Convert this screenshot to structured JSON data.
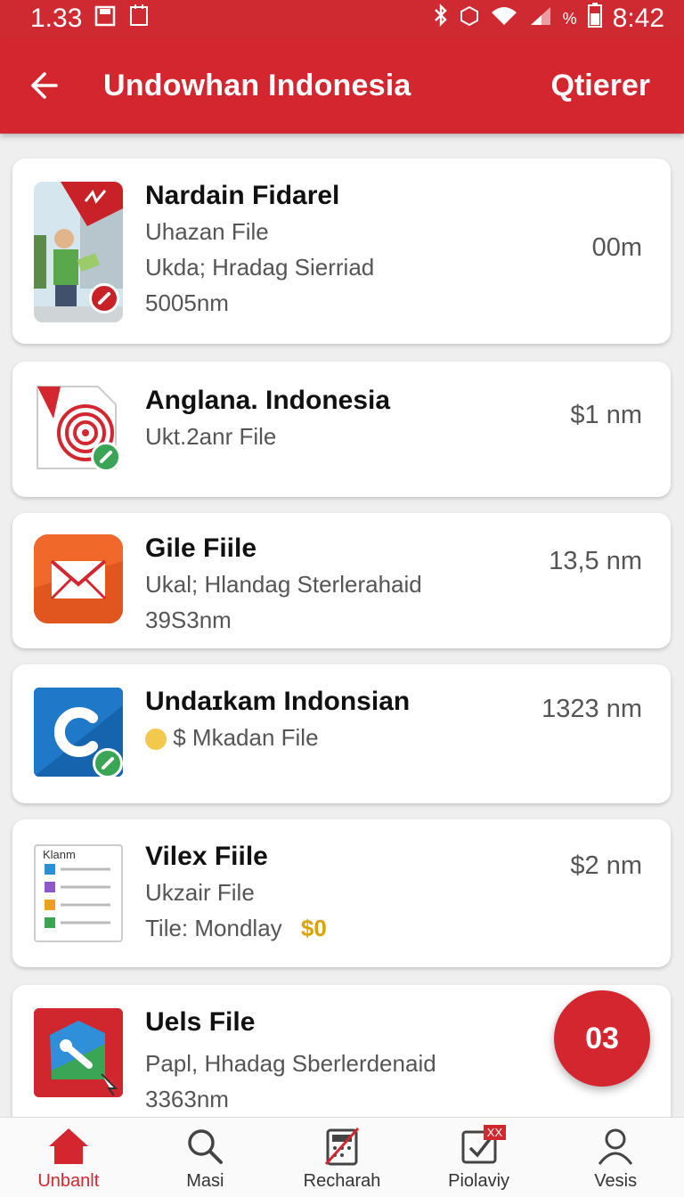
{
  "status": {
    "time_left": "1.33",
    "time_right": "8:42",
    "battery": "%"
  },
  "header": {
    "title": "Undowhan Indonesia",
    "action": "Qtierer"
  },
  "items": [
    {
      "title": "Nardain Fidarel",
      "line1": "Uhazan File",
      "line2": "Ukda; Hradag Sierriad",
      "line3": "5005nm",
      "size": "00m"
    },
    {
      "title": "Anglana. Indonesia",
      "line1": "Ukt.2anr File",
      "size": "$1 nm"
    },
    {
      "title": "Gile Fiile",
      "line1": "Ukal; Hlandag Sterlerahaid",
      "line2": "39S3nm",
      "size": "13,5 nm"
    },
    {
      "title": "Undaɪkam Indonsian",
      "line1": "$ Mkadan File",
      "size": "1323 nm"
    },
    {
      "title": "Vilex Fiile",
      "line1": "Ukzair File",
      "line2": "Tile: Mondlay",
      "line2_extra": "$0",
      "size": "$2 nm",
      "doc_header": "Klanm"
    },
    {
      "title": "Uels File",
      "line1": "Papl, Hhadag Sberlerdenaid",
      "line2": "3363nm"
    }
  ],
  "fab": {
    "label": "03"
  },
  "nav": [
    {
      "label": "Unbanlt",
      "icon": "home-icon"
    },
    {
      "label": "Masi",
      "icon": "search-icon"
    },
    {
      "label": "Recharah",
      "icon": "calculator-icon"
    },
    {
      "label": "Piolaviy",
      "icon": "checklist-icon",
      "badge": "XX"
    },
    {
      "label": "Vesis",
      "icon": "profile-icon"
    }
  ],
  "colors": {
    "brand": "#d4262f",
    "status_bar": "#cf2a31",
    "accent_gold": "#d9a400"
  }
}
